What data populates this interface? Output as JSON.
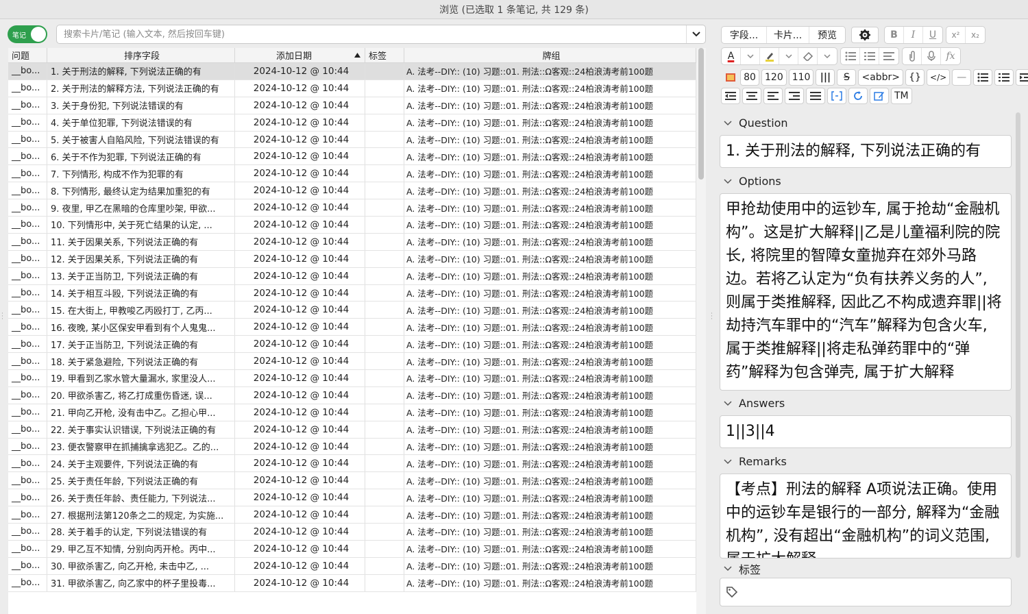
{
  "window": {
    "title": "浏览 (已选取 1 条笔记, 共 129 条)"
  },
  "toggle": {
    "label": "笔记"
  },
  "search": {
    "placeholder": "搜索卡片/笔记 (输入文本, 然后按回车键)"
  },
  "table": {
    "columns": [
      "问题",
      "排序字段",
      "添加日期",
      "标签",
      "牌组"
    ],
    "rows": [
      {
        "q": "__bo...",
        "sort": "1. 关于刑法的解释, 下列说法正确的有",
        "date": "2024-10-12 @ 10:44",
        "tag": "",
        "deck": "A. 法考--DIY:: (10)  习题::01. 刑法::Ω客观::24柏浪涛考前100题"
      },
      {
        "q": "__bo...",
        "sort": "2. 关于刑法的解释方法, 下列说法正确的有",
        "date": "2024-10-12 @ 10:44",
        "tag": "",
        "deck": "A. 法考--DIY:: (10)  习题::01. 刑法::Ω客观::24柏浪涛考前100题"
      },
      {
        "q": "__bo...",
        "sort": "3. 关于身份犯, 下列说法错误的有",
        "date": "2024-10-12 @ 10:44",
        "tag": "",
        "deck": "A. 法考--DIY:: (10)  习题::01. 刑法::Ω客观::24柏浪涛考前100题"
      },
      {
        "q": "__bo...",
        "sort": "4. 关于单位犯罪, 下列说法错误的有",
        "date": "2024-10-12 @ 10:44",
        "tag": "",
        "deck": "A. 法考--DIY:: (10)  习题::01. 刑法::Ω客观::24柏浪涛考前100题"
      },
      {
        "q": "__bo...",
        "sort": "5. 关于被害人自陷风险, 下列说法错误的有",
        "date": "2024-10-12 @ 10:44",
        "tag": "",
        "deck": "A. 法考--DIY:: (10)  习题::01. 刑法::Ω客观::24柏浪涛考前100题"
      },
      {
        "q": "__bo...",
        "sort": "6. 关于不作为犯罪, 下列说法正确的有",
        "date": "2024-10-12 @ 10:44",
        "tag": "",
        "deck": "A. 法考--DIY:: (10)  习题::01. 刑法::Ω客观::24柏浪涛考前100题"
      },
      {
        "q": "__bo...",
        "sort": "7. 下列情形, 构成不作为犯罪的有",
        "date": "2024-10-12 @ 10:44",
        "tag": "",
        "deck": "A. 法考--DIY:: (10)  习题::01. 刑法::Ω客观::24柏浪涛考前100题"
      },
      {
        "q": "__bo...",
        "sort": "8. 下列情形, 最终认定为结果加重犯的有",
        "date": "2024-10-12 @ 10:44",
        "tag": "",
        "deck": "A. 法考--DIY:: (10)  习题::01. 刑法::Ω客观::24柏浪涛考前100题"
      },
      {
        "q": "__bo...",
        "sort": "9. 夜里, 甲乙在黑暗的仓库里吵架, 甲欲...",
        "date": "2024-10-12 @ 10:44",
        "tag": "",
        "deck": "A. 法考--DIY:: (10)  习题::01. 刑法::Ω客观::24柏浪涛考前100题"
      },
      {
        "q": "__bo...",
        "sort": "10. 下列情形中, 关于死亡结果的认定, ...",
        "date": "2024-10-12 @ 10:44",
        "tag": "",
        "deck": "A. 法考--DIY:: (10)  习题::01. 刑法::Ω客观::24柏浪涛考前100题"
      },
      {
        "q": "__bo...",
        "sort": "11. 关于因果关系, 下列说法正确的有",
        "date": "2024-10-12 @ 10:44",
        "tag": "",
        "deck": "A. 法考--DIY:: (10)  习题::01. 刑法::Ω客观::24柏浪涛考前100题"
      },
      {
        "q": "__bo...",
        "sort": "12. 关于因果关系, 下列说法正确的有",
        "date": "2024-10-12 @ 10:44",
        "tag": "",
        "deck": "A. 法考--DIY:: (10)  习题::01. 刑法::Ω客观::24柏浪涛考前100题"
      },
      {
        "q": "__bo...",
        "sort": "13. 关于正当防卫, 下列说法正确的有",
        "date": "2024-10-12 @ 10:44",
        "tag": "",
        "deck": "A. 法考--DIY:: (10)  习题::01. 刑法::Ω客观::24柏浪涛考前100题"
      },
      {
        "q": "__bo...",
        "sort": "14. 关于相互斗殴, 下列说法正确的有",
        "date": "2024-10-12 @ 10:44",
        "tag": "",
        "deck": "A. 法考--DIY:: (10)  习题::01. 刑法::Ω客观::24柏浪涛考前100题"
      },
      {
        "q": "__bo...",
        "sort": "15. 在大街上, 甲教唆乙丙殴打丁, 乙丙...",
        "date": "2024-10-12 @ 10:44",
        "tag": "",
        "deck": "A. 法考--DIY:: (10)  习题::01. 刑法::Ω客观::24柏浪涛考前100题"
      },
      {
        "q": "__bo...",
        "sort": "16. 夜晚, 某小区保安甲看到有个人鬼鬼...",
        "date": "2024-10-12 @ 10:44",
        "tag": "",
        "deck": "A. 法考--DIY:: (10)  习题::01. 刑法::Ω客观::24柏浪涛考前100题"
      },
      {
        "q": "__bo...",
        "sort": "17. 关于正当防卫, 下列说法正确的有",
        "date": "2024-10-12 @ 10:44",
        "tag": "",
        "deck": "A. 法考--DIY:: (10)  习题::01. 刑法::Ω客观::24柏浪涛考前100题"
      },
      {
        "q": "__bo...",
        "sort": "18. 关于紧急避险, 下列说法正确的有",
        "date": "2024-10-12 @ 10:44",
        "tag": "",
        "deck": "A. 法考--DIY:: (10)  习题::01. 刑法::Ω客观::24柏浪涛考前100题"
      },
      {
        "q": "__bo...",
        "sort": "19. 甲看到乙家水管大量漏水, 家里没人...",
        "date": "2024-10-12 @ 10:44",
        "tag": "",
        "deck": "A. 法考--DIY:: (10)  习题::01. 刑法::Ω客观::24柏浪涛考前100题"
      },
      {
        "q": "__bo...",
        "sort": "20. 甲欲杀害乙, 将乙打成重伤昏迷, 误...",
        "date": "2024-10-12 @ 10:44",
        "tag": "",
        "deck": "A. 法考--DIY:: (10)  习题::01. 刑法::Ω客观::24柏浪涛考前100题"
      },
      {
        "q": "__bo...",
        "sort": "21. 甲向乙开枪, 没有击中乙。乙担心甲...",
        "date": "2024-10-12 @ 10:44",
        "tag": "",
        "deck": "A. 法考--DIY:: (10)  习题::01. 刑法::Ω客观::24柏浪涛考前100题"
      },
      {
        "q": "__bo...",
        "sort": "22. 关于事实认识错误, 下列说法正确的有",
        "date": "2024-10-12 @ 10:44",
        "tag": "",
        "deck": "A. 法考--DIY:: (10)  习题::01. 刑法::Ω客观::24柏浪涛考前100题"
      },
      {
        "q": "__bo...",
        "sort": "23. 便衣警察甲在抓捕擒拿逃犯乙。乙的...",
        "date": "2024-10-12 @ 10:44",
        "tag": "",
        "deck": "A. 法考--DIY:: (10)  习题::01. 刑法::Ω客观::24柏浪涛考前100题"
      },
      {
        "q": "__bo...",
        "sort": "24. 关于主观要件, 下列说法正确的有",
        "date": "2024-10-12 @ 10:44",
        "tag": "",
        "deck": "A. 法考--DIY:: (10)  习题::01. 刑法::Ω客观::24柏浪涛考前100题"
      },
      {
        "q": "__bo...",
        "sort": "25. 关于责任年龄, 下列说法正确的有",
        "date": "2024-10-12 @ 10:44",
        "tag": "",
        "deck": "A. 法考--DIY:: (10)  习题::01. 刑法::Ω客观::24柏浪涛考前100题"
      },
      {
        "q": "__bo...",
        "sort": "26. 关于责任年龄、责任能力, 下列说法...",
        "date": "2024-10-12 @ 10:44",
        "tag": "",
        "deck": "A. 法考--DIY:: (10)  习题::01. 刑法::Ω客观::24柏浪涛考前100题"
      },
      {
        "q": "__bo...",
        "sort": "27. 根据刑法第120条之二的规定, 为实施...",
        "date": "2024-10-12 @ 10:44",
        "tag": "",
        "deck": "A. 法考--DIY:: (10)  习题::01. 刑法::Ω客观::24柏浪涛考前100题"
      },
      {
        "q": "__bo...",
        "sort": "28. 关于着手的认定, 下列说法错误的有",
        "date": "2024-10-12 @ 10:44",
        "tag": "",
        "deck": "A. 法考--DIY:: (10)  习题::01. 刑法::Ω客观::24柏浪涛考前100题"
      },
      {
        "q": "__bo...",
        "sort": "29. 甲乙互不知情, 分别向丙开枪。丙中...",
        "date": "2024-10-12 @ 10:44",
        "tag": "",
        "deck": "A. 法考--DIY:: (10)  习题::01. 刑法::Ω客观::24柏浪涛考前100题"
      },
      {
        "q": "__bo...",
        "sort": "30. 甲欲杀害乙, 向乙开枪, 未击中乙, ...",
        "date": "2024-10-12 @ 10:44",
        "tag": "",
        "deck": "A. 法考--DIY:: (10)  习题::01. 刑法::Ω客观::24柏浪涛考前100题"
      },
      {
        "q": "__bo...",
        "sort": "31. 甲欲杀害乙, 向乙家中的杯子里投毒...",
        "date": "2024-10-12 @ 10:44",
        "tag": "",
        "deck": "A. 法考--DIY:: (10)  习题::01. 刑法::Ω客观::24柏浪涛考前100题"
      }
    ]
  },
  "editor": {
    "toolbar": {
      "fields_btn": "字段...",
      "cards_btn": "卡片...",
      "preview_btn": "预览",
      "sizes": [
        "80",
        "120",
        "110"
      ],
      "abbr": "<abbr>",
      "tm": "TM",
      "bold": "B",
      "italic": "I",
      "underline": "U",
      "sup": "x²",
      "sub": "x₂",
      "text_color": "A",
      "braces": "{}",
      "code": "</>",
      "em_dash": "—",
      "fx": "fx",
      "strike": "S",
      "bars": "|||"
    },
    "fields": [
      {
        "label": "Question",
        "value": "1. 关于刑法的解释, 下列说法正确的有"
      },
      {
        "label": "Options",
        "value": "甲抢劫使用中的运钞车, 属于抢劫“金融机构”。这是扩大解释||乙是儿童福利院的院长, 将院里的智障女童抛弃在郊外马路边。若将乙认定为“负有扶养义务的人”, 则属于类推解释, 因此乙不构成遗弃罪||将劫持汽车罪中的“汽车”解释为包含火车, 属于类推解释||将走私弹药罪中的“弹药”解释为包含弹壳, 属于扩大解释"
      },
      {
        "label": "Answers",
        "value": "1||3||4"
      },
      {
        "label": "Remarks",
        "value": "【考点】刑法的解释 A项说法正确。使用中的运钞车是银行的一部分, 解释为“金融机构”, 没有超出“金融机构”的词义范围, 属于扩大解释。"
      }
    ],
    "tags_label": "标签"
  }
}
